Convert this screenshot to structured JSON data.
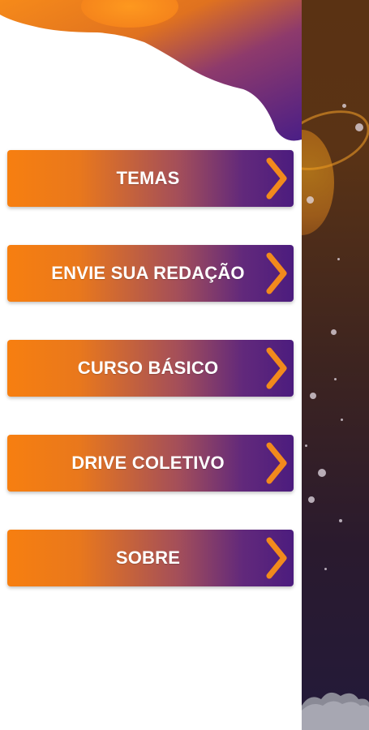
{
  "drawer": {
    "menu_items": [
      {
        "label": "TEMAS",
        "icon": "chevron-right-icon"
      },
      {
        "label": "ENVIE SUA REDAÇÃO",
        "icon": "chevron-right-icon"
      },
      {
        "label": "CURSO BÁSICO",
        "icon": "chevron-right-icon"
      },
      {
        "label": "DRIVE COLETIVO",
        "icon": "chevron-right-icon"
      },
      {
        "label": "SOBRE",
        "icon": "chevron-right-icon"
      }
    ]
  },
  "colors": {
    "accent_orange": "#f77f10",
    "accent_purple": "#4c1c7e",
    "chevron": "#f28a1c",
    "background_dark": "#2a1a2e"
  }
}
